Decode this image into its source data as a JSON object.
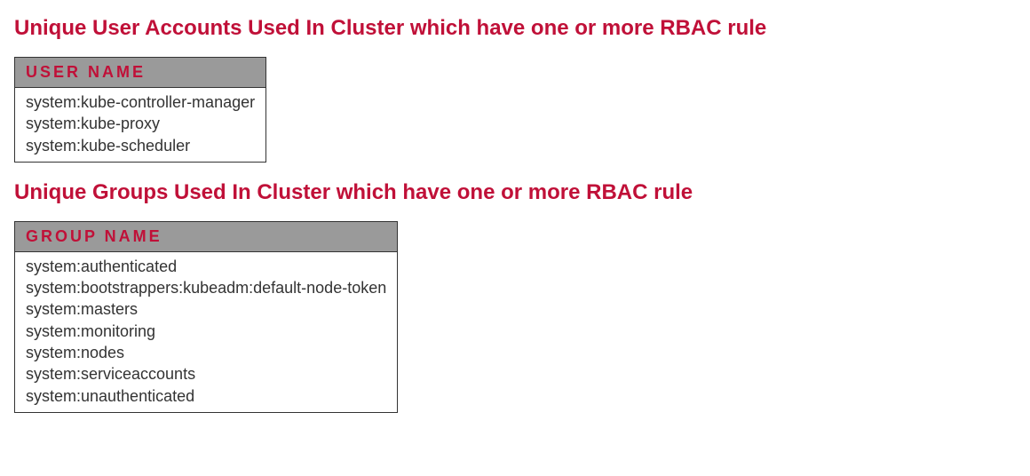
{
  "sections": [
    {
      "title": "Unique User Accounts Used In Cluster which have one or more RBAC rule",
      "header": "User Name",
      "rows": [
        "system:kube-controller-manager",
        "system:kube-proxy",
        "system:kube-scheduler"
      ]
    },
    {
      "title": "Unique Groups Used In Cluster which have one or more RBAC rule",
      "header": "Group Name",
      "rows": [
        "system:authenticated",
        "system:bootstrappers:kubeadm:default-node-token",
        "system:masters",
        "system:monitoring",
        "system:nodes",
        "system:serviceaccounts",
        "system:unauthenticated"
      ]
    }
  ]
}
